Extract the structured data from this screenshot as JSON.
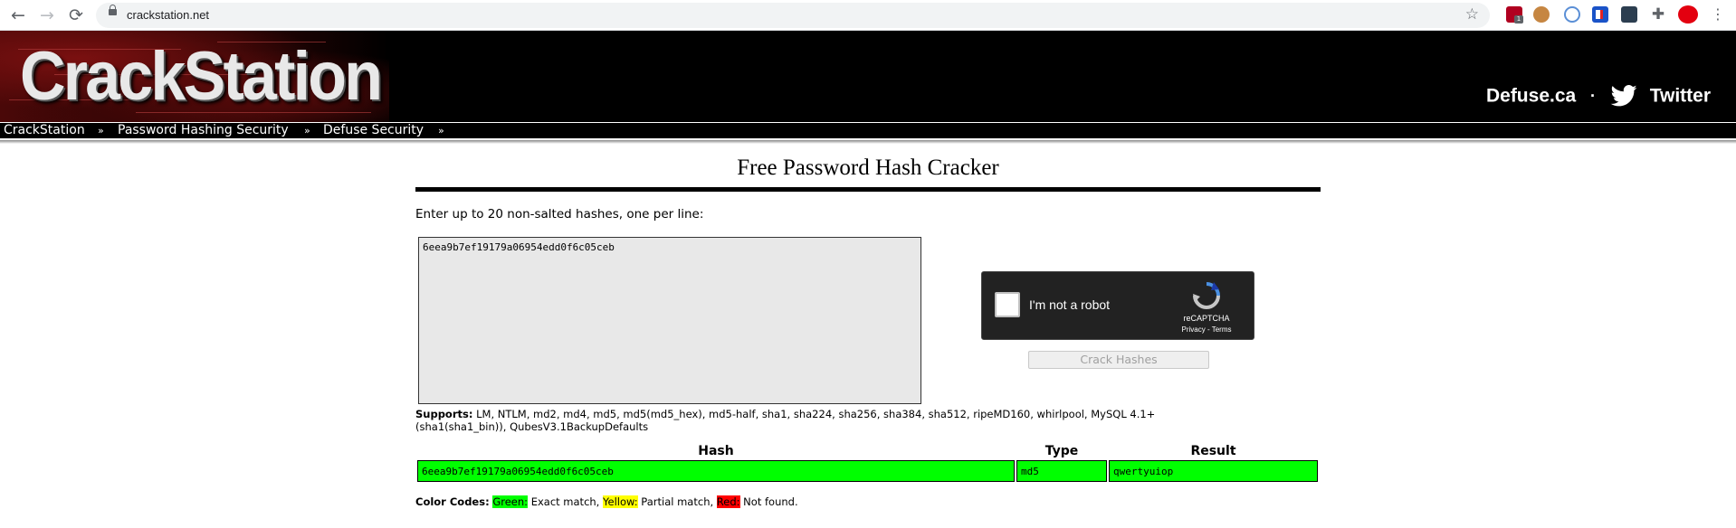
{
  "browser": {
    "url": "crackstation.net",
    "back_icon": "←",
    "forward_icon": "→",
    "reload_icon": "⟳",
    "star_icon": "☆",
    "extensions_icon": "✚",
    "menu_icon": "⋮",
    "extension_badge": "1"
  },
  "header": {
    "logo": "CrackStation",
    "defuse_link": "Defuse.ca",
    "separator": "·",
    "twitter_link": "Twitter"
  },
  "menu": {
    "items": [
      {
        "label": "CrackStation",
        "chevron": "»"
      },
      {
        "label": "Password Hashing Security",
        "chevron": "»"
      },
      {
        "label": "Defuse Security",
        "chevron": "»"
      }
    ]
  },
  "main": {
    "title": "Free Password Hash Cracker",
    "instructions": "Enter up to 20 non-salted hashes, one per line:",
    "hash_input_value": "6eea9b7ef19179a06954edd0f6c05ceb",
    "captcha": {
      "label": "I'm not a robot",
      "brand": "reCAPTCHA",
      "links": "Privacy - Terms"
    },
    "crack_button": "Crack Hashes",
    "supports_label": "Supports:",
    "supports_text": "LM, NTLM, md2, md4, md5, md5(md5_hex), md5-half, sha1, sha224, sha256, sha384, sha512, ripeMD160, whirlpool, MySQL 4.1+ (sha1(sha1_bin)), QubesV3.1BackupDefaults"
  },
  "results": {
    "headers": {
      "hash": "Hash",
      "type": "Type",
      "result": "Result"
    },
    "rows": [
      {
        "hash": "6eea9b7ef19179a06954edd0f6c05ceb",
        "type": "md5",
        "result": "qwertyuiop",
        "status_color": "#00ff00"
      }
    ]
  },
  "color_codes": {
    "label": "Color Codes:",
    "green": "Green:",
    "green_desc": " Exact match, ",
    "yellow": "Yellow:",
    "yellow_desc": " Partial match, ",
    "red": "Red:",
    "red_desc": " Not found."
  },
  "colors": {
    "exact_match": "#00ff00",
    "partial_match": "#ffff00",
    "not_found": "#ff0000",
    "banner": "#000000"
  }
}
